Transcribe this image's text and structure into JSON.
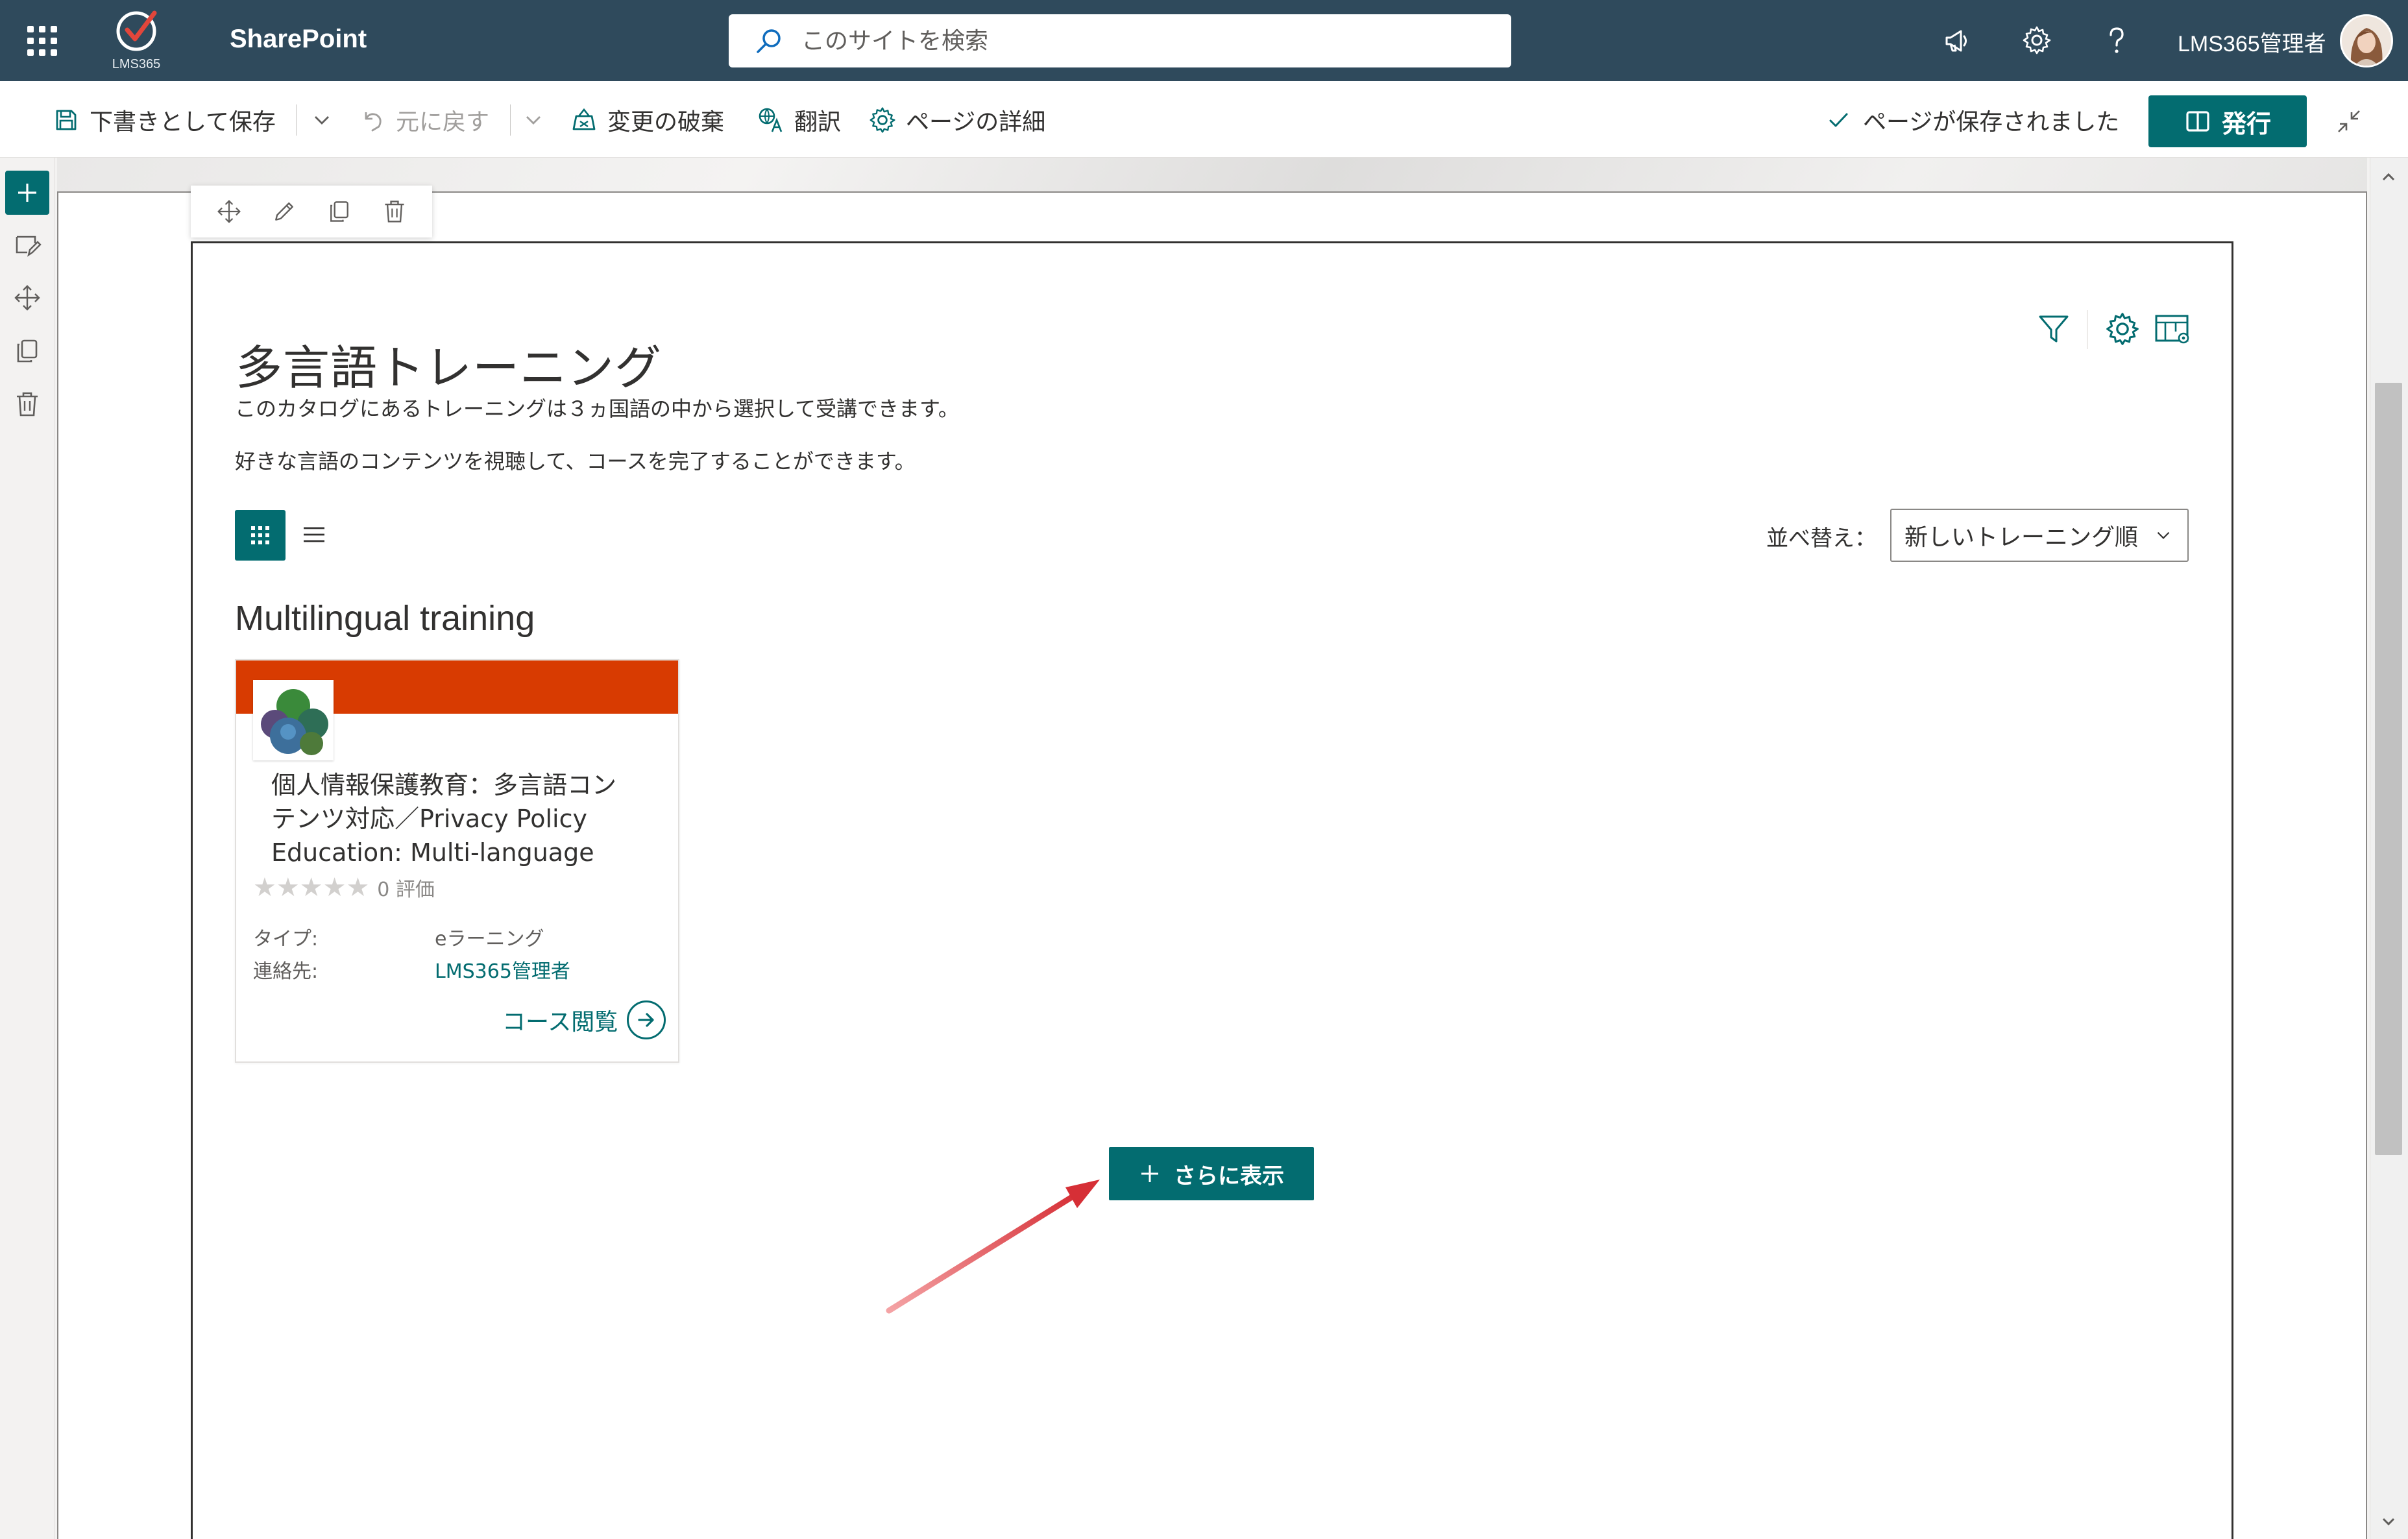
{
  "suitebar": {
    "logo_text": "LMS365",
    "app_name": "SharePoint",
    "search_placeholder": "このサイトを検索",
    "user_name": "LMS365管理者"
  },
  "commandbar": {
    "save_draft": "下書きとして保存",
    "undo": "元に戻す",
    "discard": "変更の破棄",
    "translate": "翻訳",
    "page_details": "ページの詳細",
    "saved_status": "ページが保存されました",
    "publish": "発行"
  },
  "webpart": {
    "title": "多言語トレーニング",
    "desc_line1": "このカタログにあるトレーニングは３ヵ国語の中から選択して受講できます。",
    "desc_line2": "好きな言語のコンテンツを視聴して、コースを完了することができます。",
    "sort_label": "並べ替え：",
    "sort_value": "新しいトレーニング順",
    "group_title": "Multilingual training",
    "show_more": "さらに表示"
  },
  "courses": [
    {
      "title_line1": "個人情報保護教育：多言語コン",
      "title_line2": "テンツ対応／Privacy Policy",
      "title_line3": "Education: Multi-language",
      "rating": 0,
      "rating_text": "0 評価",
      "type_label": "タイプ:",
      "type_value": "eラーニング",
      "contact_label": "連絡先:",
      "contact_value": "LMS365管理者",
      "view_label": "コース閲覧",
      "band_color": "#d83b01"
    }
  ],
  "colors": {
    "suitebar": "#2f4a5c",
    "accent": "#036c70",
    "card_band": "#d83b01",
    "annotation_arrow": "#e0585e"
  },
  "icons": {
    "waffle": "app-launcher-icon",
    "search": "search-icon",
    "megaphone": "megaphone-icon",
    "settings": "gear-icon",
    "help": "help-icon"
  }
}
